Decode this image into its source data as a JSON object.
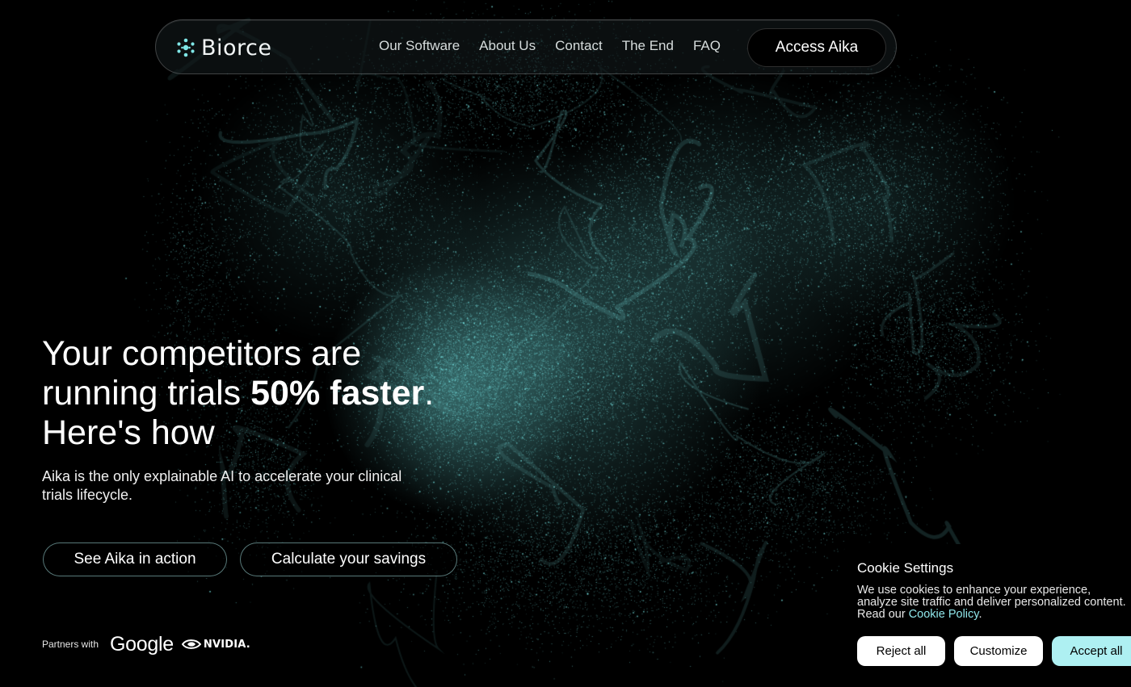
{
  "brand": {
    "name": "Biorce",
    "logo_icon": "molecule-dots-icon",
    "accent_color": "#7fe6e6"
  },
  "nav": {
    "items": [
      {
        "label": "Our Software"
      },
      {
        "label": "About Us"
      },
      {
        "label": "Contact"
      },
      {
        "label": "The End"
      },
      {
        "label": "FAQ"
      }
    ],
    "cta_label": "Access Aika"
  },
  "hero": {
    "headline_line1": "Your competitors are",
    "headline_line2_prefix": "running trials ",
    "headline_line2_bold": "50% faster",
    "headline_line2_suffix": ".",
    "headline_line3": "Here's how",
    "subheadline": "Aika is the only explainable AI to accelerate your clinical trials lifecycle.",
    "primary_button_label": "See Aika in action",
    "secondary_button_label": "Calculate your savings"
  },
  "partners": {
    "label": "Partners with",
    "google": "Google",
    "nvidia": "NVIDIA."
  },
  "cookie_banner": {
    "title": "Cookie Settings",
    "text_line1": "We use cookies to enhance your experience,",
    "text_line2": "analyze site traffic and deliver personalized content.",
    "text_line3_prefix": "Read our ",
    "policy_link": "Cookie Policy",
    "text_line3_suffix": ".",
    "reject_label": "Reject all",
    "customize_label": "Customize",
    "accept_label": "Accept all",
    "accept_color": "#aef0f2"
  },
  "background": {
    "description_icon": "particle-cloud-art",
    "particle_color": "#6fe3e0"
  }
}
